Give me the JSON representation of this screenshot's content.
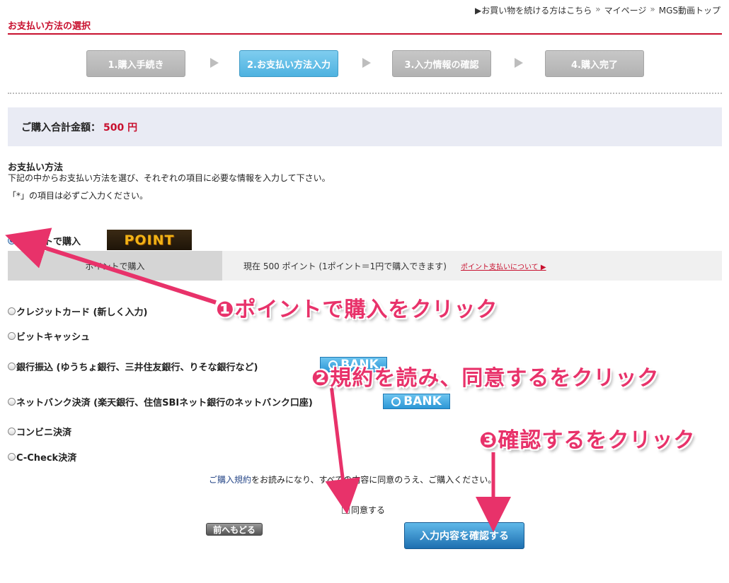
{
  "header": {
    "links": [
      {
        "text": "▶お買い物を続ける方はこちら"
      },
      {
        "text": "マイページ"
      },
      {
        "text": "MGS動画トップ"
      }
    ],
    "separator": "»",
    "page_title": "お支払い方法の選択"
  },
  "steps": [
    {
      "label": "1.購入手続き",
      "active": false
    },
    {
      "label": "2.お支払い方法入力",
      "active": true
    },
    {
      "label": "3.入力情報の確認",
      "active": false
    },
    {
      "label": "4.購入完了",
      "active": false
    }
  ],
  "total": {
    "label": "ご購入合計金額：",
    "amount": "500 円"
  },
  "payment_section": {
    "title": "お支払い方法",
    "desc": "下記の中からお支払い方法を選び、それぞれの項目に必要な情報を入力して下さい。",
    "note": "「*」の項目は必ずご入力ください。"
  },
  "methods": [
    {
      "label": "ポイントで購入",
      "checked": true
    },
    {
      "label": "クレジットカード (新しく入力)",
      "checked": false
    },
    {
      "label": "ビットキャッシュ",
      "checked": false
    },
    {
      "label": "銀行振込 (ゆうちょ銀行、三井住友銀行、りそな銀行など)",
      "checked": false
    },
    {
      "label": "ネットバンク決済 (楽天銀行、住信SBIネット銀行のネットバンク口座)",
      "checked": false
    },
    {
      "label": "コンビニ決済",
      "checked": false
    },
    {
      "label": "C-Check決済",
      "checked": false
    }
  ],
  "point_logo_text": "POINT",
  "bank_logo_text": "BANK",
  "point_detail": {
    "label": "ポイントで購入",
    "current": "現在 500 ポイント (1ポイント＝1円で購入できます)",
    "about_link": "ポイント支払いについて ▶"
  },
  "terms": {
    "link": "ご購入規約",
    "text": "をお読みになり、すべての内容に同意のうえ、ご購入ください。"
  },
  "agree_label": "同意する",
  "buttons": {
    "back": "前へもどる",
    "confirm": "入力内容を確認する"
  },
  "annotations": [
    {
      "text": "❶ポイントで購入をクリック"
    },
    {
      "text": "❷規約を読み、同意するをクリック"
    },
    {
      "text": "❸確認するをクリック"
    }
  ],
  "colors": {
    "accent_red": "#c8102e",
    "annotation_pink": "#e8326a",
    "step_active": "#4eb2e0"
  }
}
